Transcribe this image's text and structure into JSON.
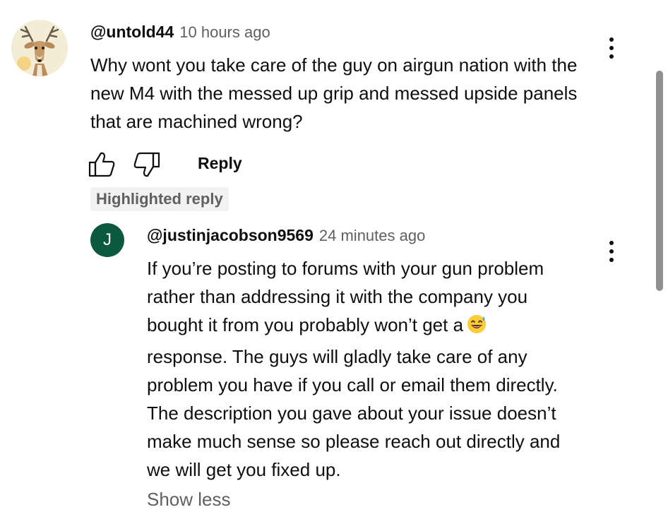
{
  "comment": {
    "handle": "@untold44",
    "time": "10 hours ago",
    "text": "Why wont you take care of the guy on airgun nation with the new M4 with the messed up grip and messed upside panels that are machined wrong?",
    "actions": {
      "reply_label": "Reply"
    }
  },
  "highlighted_badge": "Highlighted reply",
  "reply": {
    "avatar_letter": "J",
    "handle": "@justinjacobson9569",
    "time": "24 minutes ago",
    "text_part1": "If you’re posting to forums with your gun problem rather than addressing it with the company you bought it from you probably won’t get a",
    "text_part2": "response. The guys will gladly take care of any problem you have if you call or email them directly. The description you gave about your issue doesn’t make much sense so please reach out directly and we will get you fixed up.",
    "emoji": "grinning-face-with-sweat",
    "show_less_label": "Show less"
  },
  "colors": {
    "reply_avatar_bg": "#0b5a3f",
    "secondary_text": "#606060",
    "badge_bg": "#f2f2f2"
  }
}
